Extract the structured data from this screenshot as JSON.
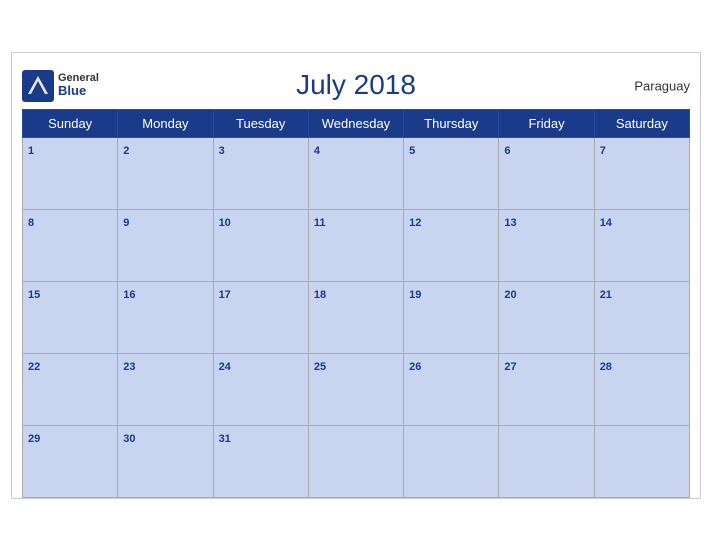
{
  "header": {
    "title": "July 2018",
    "country": "Paraguay",
    "logo": {
      "general": "General",
      "blue": "Blue"
    }
  },
  "weekdays": [
    "Sunday",
    "Monday",
    "Tuesday",
    "Wednesday",
    "Thursday",
    "Friday",
    "Saturday"
  ],
  "weeks": [
    [
      1,
      2,
      3,
      4,
      5,
      6,
      7
    ],
    [
      8,
      9,
      10,
      11,
      12,
      13,
      14
    ],
    [
      15,
      16,
      17,
      18,
      19,
      20,
      21
    ],
    [
      22,
      23,
      24,
      25,
      26,
      27,
      28
    ],
    [
      29,
      30,
      31,
      null,
      null,
      null,
      null
    ]
  ]
}
